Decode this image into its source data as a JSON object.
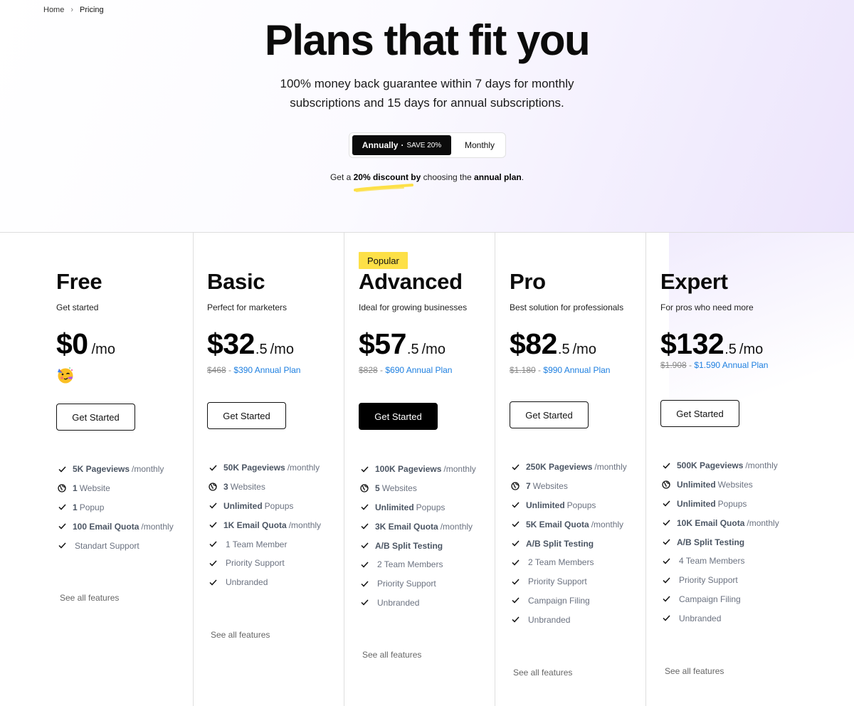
{
  "breadcrumb": {
    "home": "Home",
    "separator": "›",
    "current": "Pricing"
  },
  "hero": {
    "title": "Plans that fit you",
    "subtitle": "100% money back guarantee within 7 days for monthly subscriptions and 15 days for annual subscriptions."
  },
  "billing_toggle": {
    "annual_label": "Annually",
    "dot": "·",
    "annual_badge": "SAVE 20%",
    "monthly_label": "Monthly",
    "selected": "Annually"
  },
  "discount_note": {
    "prefix": "Get a ",
    "highlight": "20% discount by",
    "middle": " choosing the ",
    "plan": "annual plan",
    "suffix": "."
  },
  "colors": {
    "accent_link": "#1d7fe0",
    "popular_badge": "#fde047",
    "primary_button": "#000000",
    "underline_marker": "#fde047"
  },
  "plans": [
    {
      "name": "Free",
      "tagline": "Get started",
      "price": "$0",
      "cents": "",
      "per": "/mo",
      "old_price": "",
      "price_sep": "",
      "annual_price": "",
      "emoji": "partying-face",
      "cta": "Get Started",
      "see_all": "See all features",
      "features": [
        {
          "icon": "check-icon",
          "bold": "5K Pageviews",
          "text": "/monthly"
        },
        {
          "icon": "globe-icon",
          "bold": "1",
          "text": "Website"
        },
        {
          "icon": "check-icon",
          "bold": "1",
          "text": "Popup"
        },
        {
          "icon": "check-icon",
          "bold": "100 Email Quota",
          "text": "/monthly"
        },
        {
          "icon": "check-icon",
          "bold": "",
          "text": "Standart Support"
        }
      ]
    },
    {
      "name": "Basic",
      "tagline": "Perfect for marketers",
      "price": "$32",
      "cents": ".5",
      "per": "/mo",
      "old_price": "$468",
      "price_sep": "-",
      "annual_price": "$390 Annual Plan",
      "cta": "Get Started",
      "see_all": "See all features",
      "features": [
        {
          "icon": "check-icon",
          "bold": "50K Pageviews",
          "text": "/monthly"
        },
        {
          "icon": "globe-icon",
          "bold": "3",
          "text": "Websites"
        },
        {
          "icon": "check-icon",
          "bold": "Unlimited",
          "text": "Popups"
        },
        {
          "icon": "check-icon",
          "bold": "1K Email Quota",
          "text": "/monthly"
        },
        {
          "icon": "check-icon",
          "bold": "",
          "text": "1 Team Member"
        },
        {
          "icon": "check-icon",
          "bold": "",
          "text": "Priority Support"
        },
        {
          "icon": "check-icon",
          "bold": "",
          "text": "Unbranded"
        }
      ]
    },
    {
      "name": "Advanced",
      "badge": "Popular",
      "tagline": "Ideal for growing businesses",
      "price": "$57",
      "cents": ".5",
      "per": "/mo",
      "old_price": "$828",
      "price_sep": "-",
      "annual_price": "$690 Annual Plan",
      "cta": "Get Started",
      "see_all": "See all features",
      "features": [
        {
          "icon": "check-icon",
          "bold": "100K Pageviews",
          "text": "/monthly"
        },
        {
          "icon": "globe-icon",
          "bold": "5",
          "text": "Websites"
        },
        {
          "icon": "check-icon",
          "bold": "Unlimited",
          "text": "Popups"
        },
        {
          "icon": "check-icon",
          "bold": "3K Email Quota",
          "text": "/monthly"
        },
        {
          "icon": "check-icon",
          "bold": "A/B Split Testing",
          "text": ""
        },
        {
          "icon": "check-icon",
          "bold": "",
          "text": "2 Team Members"
        },
        {
          "icon": "check-icon",
          "bold": "",
          "text": "Priority Support"
        },
        {
          "icon": "check-icon",
          "bold": "",
          "text": "Unbranded"
        }
      ]
    },
    {
      "name": "Pro",
      "tagline": "Best solution for professionals",
      "price": "$82",
      "cents": ".5",
      "per": "/mo",
      "old_price": "$1.180",
      "price_sep": "-",
      "annual_price": "$990 Annual Plan",
      "cta": "Get Started",
      "see_all": "See all features",
      "features": [
        {
          "icon": "check-icon",
          "bold": "250K Pageviews",
          "text": "/monthly"
        },
        {
          "icon": "globe-icon",
          "bold": "7",
          "text": "Websites"
        },
        {
          "icon": "check-icon",
          "bold": "Unlimited",
          "text": "Popups"
        },
        {
          "icon": "check-icon",
          "bold": "5K Email Quota",
          "text": "/monthly"
        },
        {
          "icon": "check-icon",
          "bold": "A/B Split Testing",
          "text": ""
        },
        {
          "icon": "check-icon",
          "bold": "",
          "text": "2 Team Members"
        },
        {
          "icon": "check-icon",
          "bold": "",
          "text": "Priority Support"
        },
        {
          "icon": "check-icon",
          "bold": "",
          "text": "Campaign Filing"
        },
        {
          "icon": "check-icon",
          "bold": "",
          "text": "Unbranded"
        }
      ]
    },
    {
      "name": "Expert",
      "tagline": "For pros who need more",
      "price": "$132",
      "cents": ".5",
      "per": "/mo",
      "old_price": "$1.908",
      "price_sep": "-",
      "annual_price": "$1.590 Annual Plan",
      "cta": "Get Started",
      "see_all": "See all features",
      "features": [
        {
          "icon": "check-icon",
          "bold": "500K Pageviews",
          "text": "/monthly"
        },
        {
          "icon": "globe-icon",
          "bold": "Unlimited",
          "text": "Websites"
        },
        {
          "icon": "check-icon",
          "bold": "Unlimited",
          "text": "Popups"
        },
        {
          "icon": "check-icon",
          "bold": "10K Email Quota",
          "text": "/monthly"
        },
        {
          "icon": "check-icon",
          "bold": "A/B Split Testing",
          "text": ""
        },
        {
          "icon": "check-icon",
          "bold": "",
          "text": "4 Team Members"
        },
        {
          "icon": "check-icon",
          "bold": "",
          "text": "Priority Support"
        },
        {
          "icon": "check-icon",
          "bold": "",
          "text": "Campaign Filing"
        },
        {
          "icon": "check-icon",
          "bold": "",
          "text": "Unbranded"
        }
      ]
    }
  ]
}
